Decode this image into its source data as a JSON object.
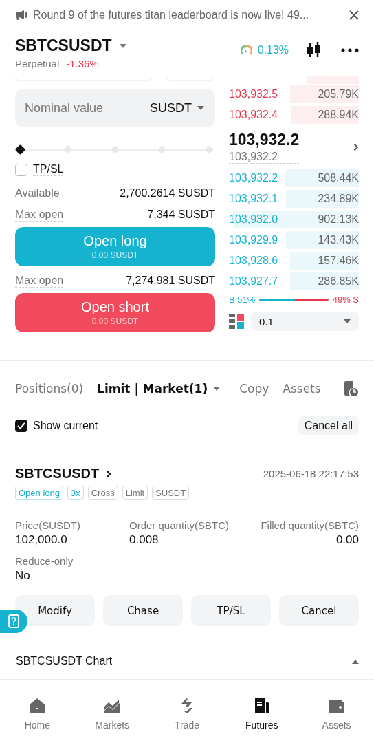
{
  "announcement": {
    "text": "Round 9 of the futures titan leaderboard is now live! 49..."
  },
  "header": {
    "symbol": "SBTCSUSDT",
    "contract": "Perpetual",
    "change": "-1.36%",
    "funding": "0.13%"
  },
  "order_form": {
    "amount_field": {
      "placeholder": "Nominal value",
      "unit": "SUSDT"
    },
    "slider": {
      "level": 0
    },
    "tpsl": {
      "label": "TP/SL",
      "checked": false
    },
    "available": {
      "label": "Available",
      "value": "2,700.2614 SUSDT"
    },
    "long_max": {
      "label": "Max open",
      "value": "7,344 SUSDT"
    },
    "long_button": {
      "label": "Open long",
      "amount": "0.00 SUSDT"
    },
    "short_max": {
      "label": "Max open",
      "value": "7,274.981 SUSDT"
    },
    "short_button": {
      "label": "Open short",
      "amount": "0.00 SUSDT"
    }
  },
  "order_book": {
    "asks": [
      {
        "price": "103,932.5",
        "size": "205.79K"
      },
      {
        "price": "103,932.4",
        "size": "288.94K"
      }
    ],
    "last_price": "103,932.2",
    "mark_price": "103,932.2",
    "bids": [
      {
        "price": "103,932.2",
        "size": "508.44K"
      },
      {
        "price": "103,932.1",
        "size": "234.89K"
      },
      {
        "price": "103,932.0",
        "size": "902.13K"
      },
      {
        "price": "103,929.9",
        "size": "143.43K"
      },
      {
        "price": "103,928.6",
        "size": "157.46K"
      },
      {
        "price": "103,927.7",
        "size": "286.85K"
      }
    ],
    "buy_label": "B 51%",
    "sell_label": "49% S",
    "buy_share": {
      "level": 0.51
    },
    "precision": "0.1"
  },
  "order_tabs": [
    {
      "label": "Positions(0)",
      "selected": false,
      "dropdown": false
    },
    {
      "label": "Limit | Market(1)",
      "selected": true,
      "dropdown": true
    },
    {
      "label": "Copy",
      "selected": false,
      "dropdown": false
    },
    {
      "label": "Assets",
      "selected": false,
      "dropdown": false
    }
  ],
  "show_current": {
    "label": "Show current",
    "checked": true
  },
  "cancel_all": "Cancel all",
  "order": {
    "symbol": "SBTCSUSDT",
    "time": "2025-06-18 22:17:53",
    "tags": [
      {
        "label": "Open long",
        "kind": "accent"
      },
      {
        "label": "3x",
        "kind": "accent"
      },
      {
        "label": "Cross",
        "kind": "plain"
      },
      {
        "label": "Limit",
        "kind": "plain"
      },
      {
        "label": "SUSDT",
        "kind": "plain"
      }
    ],
    "fields": [
      {
        "label": "Price(SUSDT)",
        "value": "102,000.0"
      },
      {
        "label": "Order quantity(SBTC)",
        "value": "0.008"
      },
      {
        "label": "Filled quantity(SBTC)",
        "value": "0.00"
      },
      {
        "label": "Reduce-only",
        "value": "No"
      }
    ],
    "actions": [
      "Modify",
      "Chase",
      "TP/SL",
      "Cancel"
    ]
  },
  "chart_section": {
    "title": "SBTCSUSDT Chart",
    "expanded": true
  },
  "nav": [
    {
      "label": "Home",
      "selected": false,
      "kind": "home"
    },
    {
      "label": "Markets",
      "selected": false,
      "kind": "markets"
    },
    {
      "label": "Trade",
      "selected": false,
      "kind": "trade"
    },
    {
      "label": "Futures",
      "selected": true,
      "kind": "futures"
    },
    {
      "label": "Assets",
      "selected": false,
      "kind": "assets"
    }
  ]
}
